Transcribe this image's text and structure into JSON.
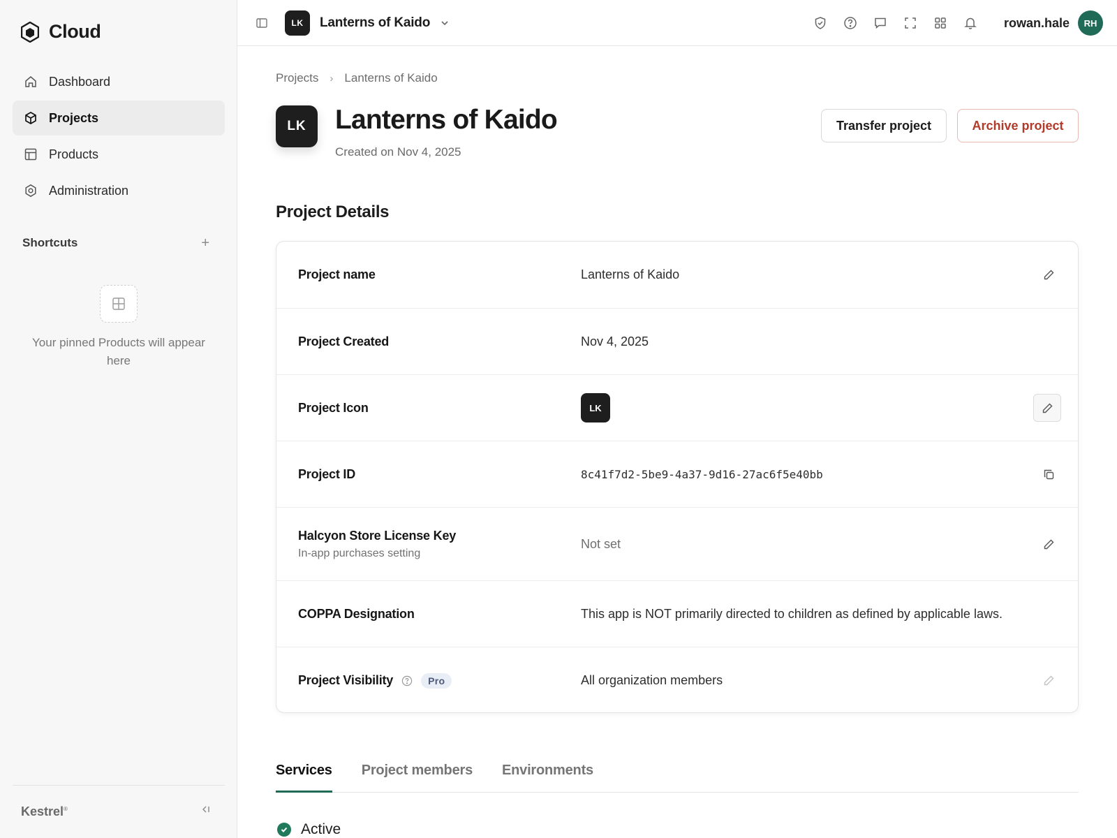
{
  "sidebar": {
    "brand": "Cloud",
    "nav": [
      {
        "label": "Dashboard",
        "icon": "home-icon"
      },
      {
        "label": "Projects",
        "icon": "cube-icon",
        "active": true
      },
      {
        "label": "Products",
        "icon": "layout-icon"
      },
      {
        "label": "Administration",
        "icon": "gear-icon"
      }
    ],
    "shortcuts_title": "Shortcuts",
    "pinned_empty": "Your pinned Products will appear here",
    "footer_brand": "Kestrel",
    "footer_mark": "®"
  },
  "topbar": {
    "project_initials": "LK",
    "project_name": "Lanterns of Kaido",
    "username": "rowan.hale",
    "user_initials": "RH"
  },
  "breadcrumb": {
    "root": "Projects",
    "current": "Lanterns of Kaido"
  },
  "header": {
    "initials": "LK",
    "title": "Lanterns of Kaido",
    "subtitle": "Created on Nov 4, 2025",
    "transfer_label": "Transfer project",
    "archive_label": "Archive project"
  },
  "details": {
    "title": "Project Details",
    "rows": [
      {
        "label": "Project name",
        "value": "Lanterns of Kaido"
      },
      {
        "label": "Project Created",
        "value": "Nov 4, 2025"
      },
      {
        "label": "Project Icon",
        "value": "LK"
      },
      {
        "label": "Project ID",
        "value": "8c41f7d2-5be9-4a37-9d16-27ac6f5e40bb"
      },
      {
        "label": "Halcyon Store License Key",
        "sublabel": "In-app purchases setting",
        "value": "Not set"
      },
      {
        "label": "COPPA Designation",
        "value": "This app is NOT primarily directed to children as defined by applicable laws."
      },
      {
        "label": "Project Visibility",
        "badge": "Pro",
        "value": "All organization members"
      }
    ]
  },
  "tabs": [
    "Services",
    "Project members",
    "Environments"
  ],
  "status": {
    "label": "Active"
  },
  "colors": {
    "accent": "#1f6b57",
    "danger": "#b23a2a"
  }
}
